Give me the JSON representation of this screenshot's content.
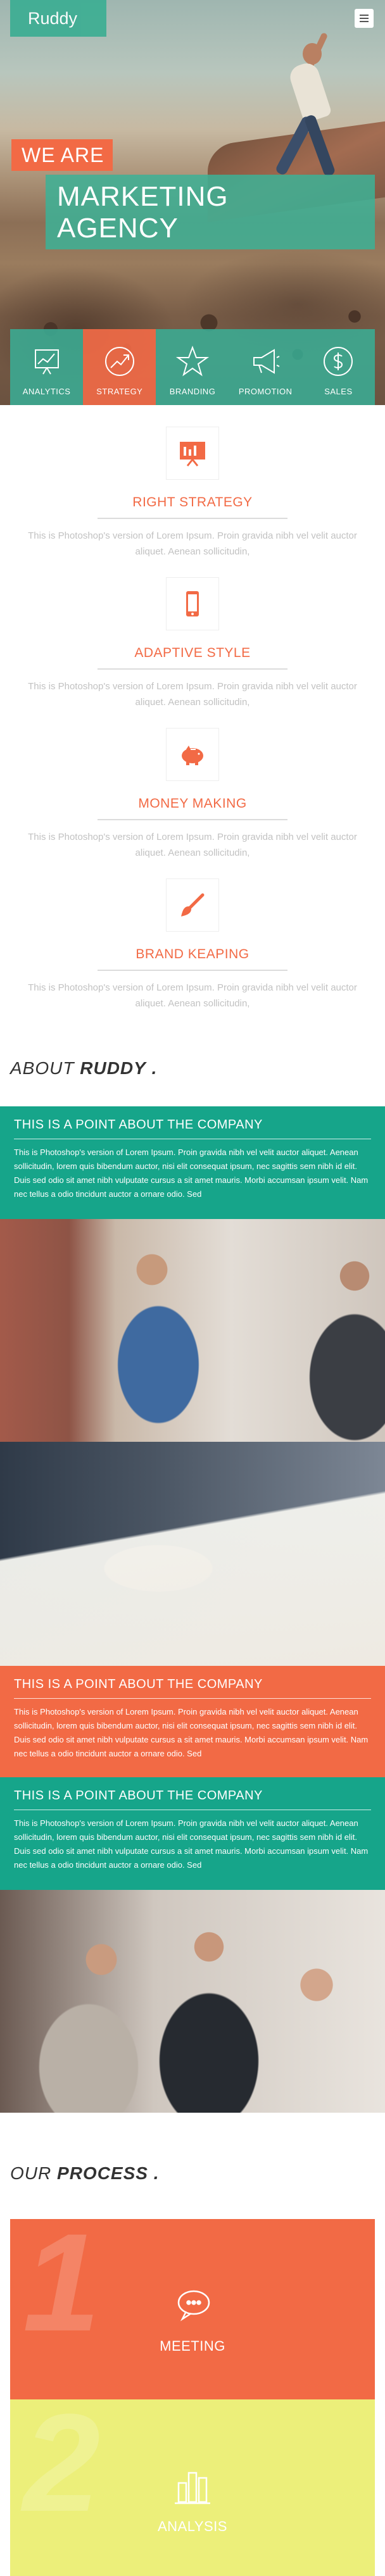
{
  "header": {
    "brand": "Ruddy",
    "menu_icon": "hamburger-icon"
  },
  "hero": {
    "kicker": "WE ARE",
    "headline_line1": "MARKETING",
    "headline_line2": "AGENCY"
  },
  "services": [
    {
      "label": "ANALYTICS",
      "icon": "chart-icon",
      "active": false
    },
    {
      "label": "STRATEGY",
      "icon": "growth-arrow-icon",
      "active": true
    },
    {
      "label": "BRANDING",
      "icon": "star-icon",
      "active": false
    },
    {
      "label": "PROMOTION",
      "icon": "megaphone-icon",
      "active": false
    },
    {
      "label": "SALES",
      "icon": "dollar-icon",
      "active": false
    }
  ],
  "features": [
    {
      "title": "RIGHT STRATEGY",
      "icon": "presentation-icon",
      "text": "This is Photoshop's version of Lorem Ipsum. Proin gravida nibh vel velit auctor aliquet. Aenean sollicitudin,"
    },
    {
      "title": "ADAPTIVE STYLE",
      "icon": "mobile-icon",
      "text": "This is Photoshop's version of Lorem Ipsum. Proin gravida nibh vel velit auctor aliquet. Aenean sollicitudin,"
    },
    {
      "title": "MONEY MAKING",
      "icon": "piggy-bank-icon",
      "text": "This is Photoshop's version of Lorem Ipsum. Proin gravida nibh vel velit auctor aliquet. Aenean sollicitudin,"
    },
    {
      "title": "BRAND KEAPING",
      "icon": "brush-icon",
      "text": "This is Photoshop's version of Lorem Ipsum. Proin gravida nibh vel velit auctor aliquet. Aenean sollicitudin,"
    }
  ],
  "about": {
    "title_prefix": "ABOUT",
    "title_brand": "RUDDY",
    "title_suffix": ".",
    "points": [
      {
        "title": "THIS IS A POINT ABOUT THE COMPANY",
        "text": "This is Photoshop's version of Lorem Ipsum. Proin gravida nibh vel velit auctor aliquet. Aenean sollicitudin, lorem quis bibendum auctor, nisi elit consequat ipsum, nec sagittis sem nibh id elit. Duis sed odio sit amet nibh vulputate cursus a sit amet mauris. Morbi accumsan ipsum velit. Nam nec tellus a odio tincidunt auctor a ornare odio. Sed"
      },
      {
        "title": "THIS IS A POINT ABOUT THE COMPANY",
        "text": "This is Photoshop's version of Lorem Ipsum. Proin gravida nibh vel velit auctor aliquet. Aenean sollicitudin, lorem quis bibendum auctor, nisi elit consequat ipsum, nec sagittis sem nibh id elit. Duis sed odio sit amet nibh vulputate cursus a sit amet mauris. Morbi accumsan ipsum velit. Nam nec tellus a odio tincidunt auctor a ornare odio. Sed"
      },
      {
        "title": "THIS IS A POINT ABOUT THE COMPANY",
        "text": "This is Photoshop's version of Lorem Ipsum. Proin gravida nibh vel velit auctor aliquet. Aenean sollicitudin, lorem quis bibendum auctor, nisi elit consequat ipsum, nec sagittis sem nibh id elit. Duis sed odio sit amet nibh vulputate cursus a sit amet mauris. Morbi accumsan ipsum velit. Nam nec tellus a odio tincidunt auctor a ornare odio. Sed"
      }
    ]
  },
  "process": {
    "title_prefix": "OUR",
    "title_main": "PROCESS",
    "title_suffix": ".",
    "steps": [
      {
        "number": "1",
        "label": "MEETING",
        "icon": "chat-bubbles-icon"
      },
      {
        "number": "2",
        "label": "ANALYSIS",
        "icon": "bar-chart-icon"
      }
    ]
  },
  "colors": {
    "green": "#16a58a",
    "orange": "#f26a45",
    "yellow": "#ecef7a",
    "muted_text": "#c2c2c2"
  }
}
